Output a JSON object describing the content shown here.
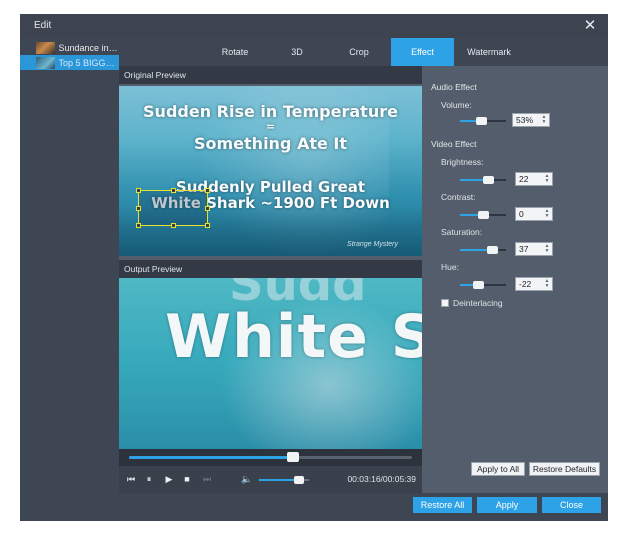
{
  "window": {
    "title": "Edit",
    "close_icon": "close-icon"
  },
  "file_list": [
    {
      "name": "Sundance in 4...",
      "selected": false
    },
    {
      "name": "Top 5 BIGGES...",
      "selected": true
    }
  ],
  "tabs": [
    "Rotate",
    "3D",
    "Crop",
    "Effect",
    "Watermark"
  ],
  "active_tab": "Effect",
  "original_preview": {
    "label": "Original Preview",
    "video_text": [
      "Sudden Rise in Temperature",
      "=",
      "Something Ate It",
      "Suddenly Pulled Great",
      "White Shark ~1900 Ft Down"
    ],
    "watermark": "Strange Mystery"
  },
  "output_preview": {
    "label": "Output Preview",
    "video_text": "White S",
    "ghost_text": "Sudd"
  },
  "player": {
    "seek_progress": 0.58,
    "volume_level": 0.8,
    "time": "00:03:16/00:05:39"
  },
  "effect": {
    "audio_title": "Audio Effect",
    "volume_label": "Volume:",
    "volume_value": "53%",
    "volume_level": 0.45,
    "video_title": "Video Effect",
    "brightness_label": "Brightness:",
    "brightness_value": "22",
    "brightness_level": 0.61,
    "contrast_label": "Contrast:",
    "contrast_value": "0",
    "contrast_level": 0.5,
    "saturation_label": "Saturation:",
    "saturation_value": "37",
    "saturation_level": 0.69,
    "hue_label": "Hue:",
    "hue_value": "-22",
    "hue_level": 0.39,
    "deinterlacing_label": "Deinterlacing",
    "deinterlacing_checked": false,
    "apply_to_all": "Apply to All",
    "restore_defaults": "Restore Defaults"
  },
  "footer": {
    "restore_all": "Restore All",
    "apply": "Apply",
    "close": "Close"
  },
  "colors": {
    "accent": "#2ea2e6",
    "crop_box": "#e7e12d",
    "window_bg": "#545d6b",
    "dark_bg": "#3f4653"
  }
}
